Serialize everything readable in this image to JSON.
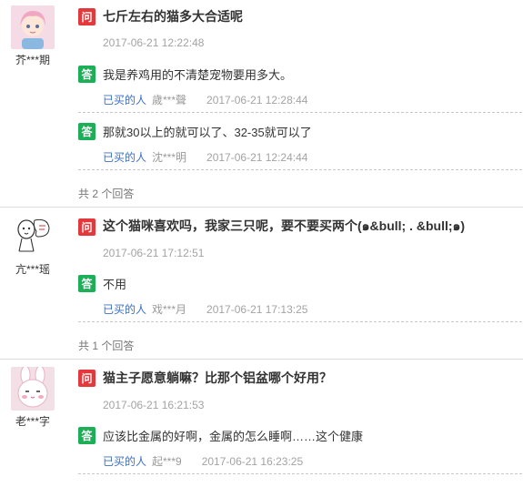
{
  "badges": {
    "question": "问",
    "answer": "答",
    "bought": "已买的人"
  },
  "threads": [
    {
      "user": {
        "name": "芥***期",
        "avatar_icon": "anime-girl-avatar"
      },
      "question": {
        "text": "七斤左右的猫多大合适呢",
        "time": "2017-06-21 12:22:48"
      },
      "answers": [
        {
          "text": "我是养鸡用的不清楚宠物要用多大。",
          "user": "歲***聲",
          "time": "2017-06-21 12:28:44"
        },
        {
          "text": "那就30以上的就可以了、32-35就可以了",
          "user": "沈***明",
          "time": "2017-06-21 12:24:44"
        }
      ],
      "count": "共 2 个回答"
    },
    {
      "user": {
        "name": "亢***瑶",
        "avatar_icon": "doodle-character-avatar"
      },
      "question": {
        "text": "这个猫咪喜欢吗，我家三只呢，要不要买两个(๑&bull; . &bull;๑)",
        "time": "2017-06-21 17:12:51"
      },
      "answers": [
        {
          "text": "不用",
          "user": "戏***月",
          "time": "2017-06-21 17:13:25"
        }
      ],
      "count": "共 1 个回答"
    },
    {
      "user": {
        "name": "老***字",
        "avatar_icon": "bunny-avatar"
      },
      "question": {
        "text": "猫主子愿意躺嘛？比那个铝盆哪个好用？",
        "time": "2017-06-21 16:21:53"
      },
      "answers": [
        {
          "text": "应该比金属的好啊，金属的怎么睡啊……这个健康",
          "user": "起***9",
          "time": "2017-06-21 16:23:25"
        }
      ]
    }
  ],
  "colors": {
    "question_badge": "#e4393c",
    "answer_badge": "#1caf57",
    "link": "#3b6fc4"
  }
}
